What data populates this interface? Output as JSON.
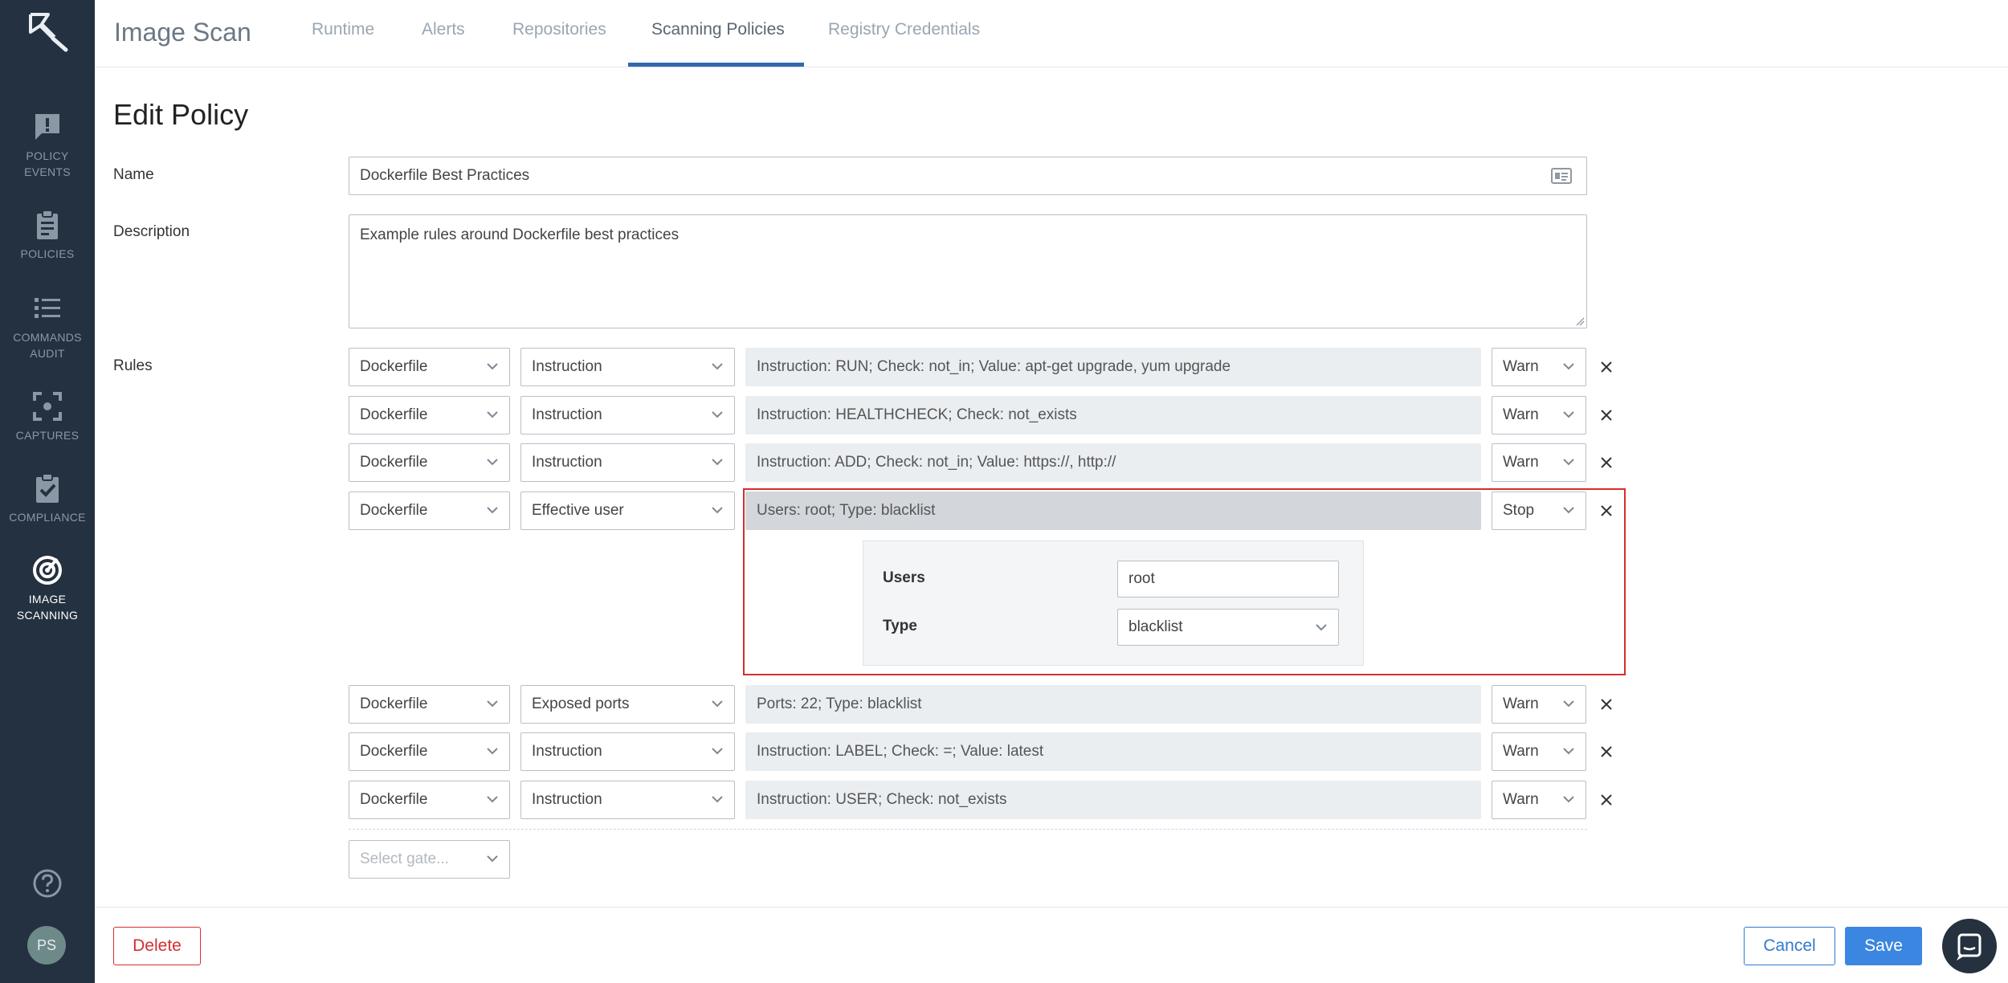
{
  "app": {
    "title": "Image Scan"
  },
  "sidebar": {
    "items": [
      {
        "label_line1": "POLICY",
        "label_line2": "EVENTS",
        "icon": "alert-message-icon"
      },
      {
        "label_line1": "POLICIES",
        "label_line2": "",
        "icon": "clipboard-icon"
      },
      {
        "label_line1": "COMMANDS",
        "label_line2": "AUDIT",
        "icon": "list-icon"
      },
      {
        "label_line1": "CAPTURES",
        "label_line2": "",
        "icon": "capture-icon"
      },
      {
        "label_line1": "COMPLIANCE",
        "label_line2": "",
        "icon": "clipboard-check-icon"
      },
      {
        "label_line1": "IMAGE",
        "label_line2": "SCANNING",
        "icon": "radar-icon",
        "active": true
      }
    ],
    "avatar_initials": "PS"
  },
  "tabs": [
    {
      "label": "Runtime"
    },
    {
      "label": "Alerts"
    },
    {
      "label": "Repositories"
    },
    {
      "label": "Scanning Policies",
      "active": true
    },
    {
      "label": "Registry Credentials"
    }
  ],
  "page": {
    "title": "Edit Policy"
  },
  "form": {
    "name_label": "Name",
    "name_value": "Dockerfile Best Practices",
    "description_label": "Description",
    "description_value": "Example rules around Dockerfile best practices",
    "rules_label": "Rules"
  },
  "rules": [
    {
      "gate": "Dockerfile",
      "trigger": "Instruction",
      "summary": "Instruction: RUN; Check: not_in; Value: apt-get upgrade, yum upgrade",
      "action": "Warn"
    },
    {
      "gate": "Dockerfile",
      "trigger": "Instruction",
      "summary": "Instruction: HEALTHCHECK; Check: not_exists",
      "action": "Warn"
    },
    {
      "gate": "Dockerfile",
      "trigger": "Instruction",
      "summary": "Instruction: ADD; Check: not_in; Value: https://, http://",
      "action": "Warn"
    },
    {
      "gate": "Dockerfile",
      "trigger": "Effective user",
      "summary": "Users: root; Type: blacklist",
      "action": "Stop",
      "expanded": true
    },
    {
      "gate": "Dockerfile",
      "trigger": "Exposed ports",
      "summary": "Ports: 22; Type: blacklist",
      "action": "Warn"
    },
    {
      "gate": "Dockerfile",
      "trigger": "Instruction",
      "summary": "Instruction: LABEL; Check: =; Value: latest",
      "action": "Warn"
    },
    {
      "gate": "Dockerfile",
      "trigger": "Instruction",
      "summary": "Instruction: USER; Check: not_exists",
      "action": "Warn"
    }
  ],
  "rule_params": {
    "users_label": "Users",
    "users_value": "root",
    "type_label": "Type",
    "type_value": "blacklist"
  },
  "new_rule": {
    "gate_placeholder": "Select gate..."
  },
  "footer": {
    "delete_label": "Delete",
    "cancel_label": "Cancel",
    "save_label": "Save"
  },
  "colors": {
    "sidebar_bg": "#243140",
    "accent": "#3b86e0",
    "danger": "#d32f2f",
    "tab_underline": "#2f6aad"
  }
}
